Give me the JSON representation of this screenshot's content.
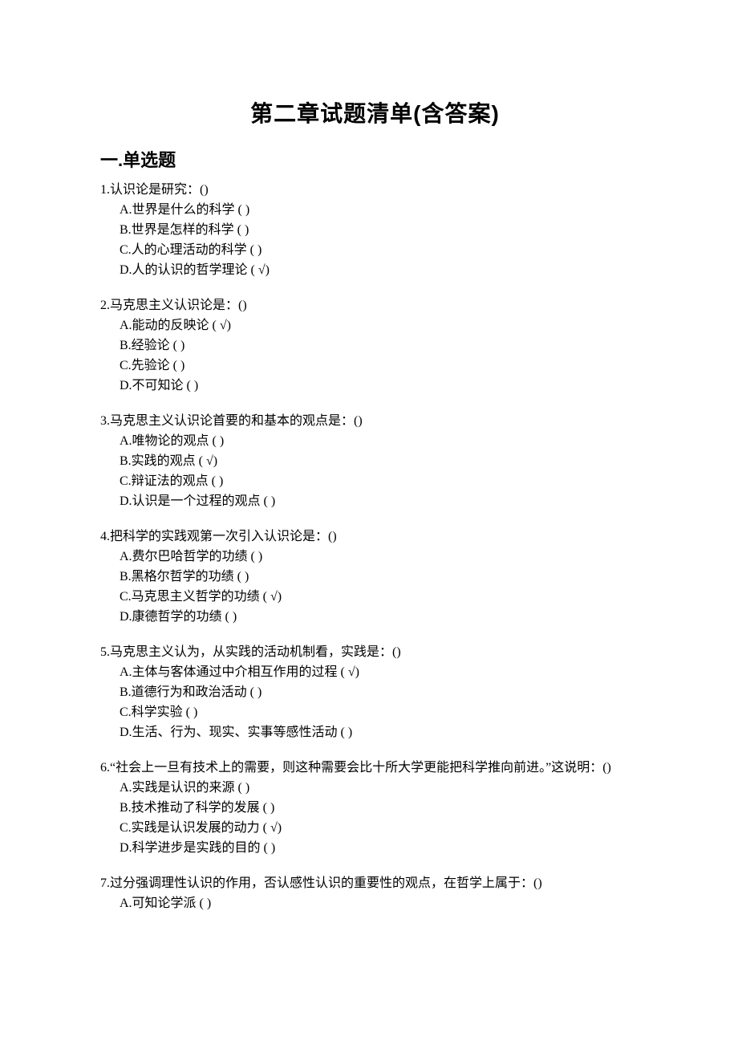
{
  "title": "第二章试题清单(含答案)",
  "section_heading": "一.单选题",
  "option_labels": [
    "A",
    "B",
    "C",
    "D"
  ],
  "mark_unchecked": "(  )",
  "mark_checked": "( √)",
  "questions": [
    {
      "num": "1",
      "stem": "认识论是研究：()",
      "options": [
        {
          "text": "世界是什么的科学",
          "correct": false
        },
        {
          "text": "世界是怎样的科学",
          "correct": false
        },
        {
          "text": "人的心理活动的科学",
          "correct": false
        },
        {
          "text": "人的认识的哲学理论",
          "correct": true
        }
      ]
    },
    {
      "num": "2",
      "stem": "马克思主义认识论是：()",
      "options": [
        {
          "text": "能动的反映论",
          "correct": true
        },
        {
          "text": "经验论",
          "correct": false
        },
        {
          "text": "先验论",
          "correct": false
        },
        {
          "text": "不可知论",
          "correct": false
        }
      ]
    },
    {
      "num": "3",
      "stem": "马克思主义认识论首要的和基本的观点是：()",
      "options": [
        {
          "text": "唯物论的观点",
          "correct": false
        },
        {
          "text": "实践的观点",
          "correct": true
        },
        {
          "text": "辩证法的观点",
          "correct": false
        },
        {
          "text": "认识是一个过程的观点",
          "correct": false
        }
      ]
    },
    {
      "num": "4",
      "stem": "把科学的实践观第一次引入认识论是：()",
      "options": [
        {
          "text": "费尔巴哈哲学的功绩",
          "correct": false
        },
        {
          "text": "黑格尔哲学的功绩",
          "correct": false
        },
        {
          "text": "马克思主义哲学的功绩",
          "correct": true
        },
        {
          "text": "康德哲学的功绩",
          "correct": false
        }
      ]
    },
    {
      "num": "5",
      "stem": "马克思主义认为，从实践的活动机制看，实践是：()",
      "options": [
        {
          "text": "主体与客体通过中介相互作用的过程",
          "correct": true
        },
        {
          "text": "道德行为和政治活动",
          "correct": false
        },
        {
          "text": "科学实验",
          "correct": false
        },
        {
          "text": "生活、行为、现实、实事等感性活动",
          "correct": false
        }
      ]
    },
    {
      "num": "6",
      "stem": "“社会上一旦有技术上的需要，则这种需要会比十所大学更能把科学推向前进。”这说明：()",
      "options": [
        {
          "text": "实践是认识的来源",
          "correct": false
        },
        {
          "text": "技术推动了科学的发展",
          "correct": false
        },
        {
          "text": "实践是认识发展的动力",
          "correct": true
        },
        {
          "text": "科学进步是实践的目的",
          "correct": false
        }
      ]
    },
    {
      "num": "7",
      "stem": "过分强调理性认识的作用，否认感性认识的重要性的观点，在哲学上属于：()",
      "options": [
        {
          "text": "可知论学派",
          "correct": false
        }
      ]
    }
  ]
}
